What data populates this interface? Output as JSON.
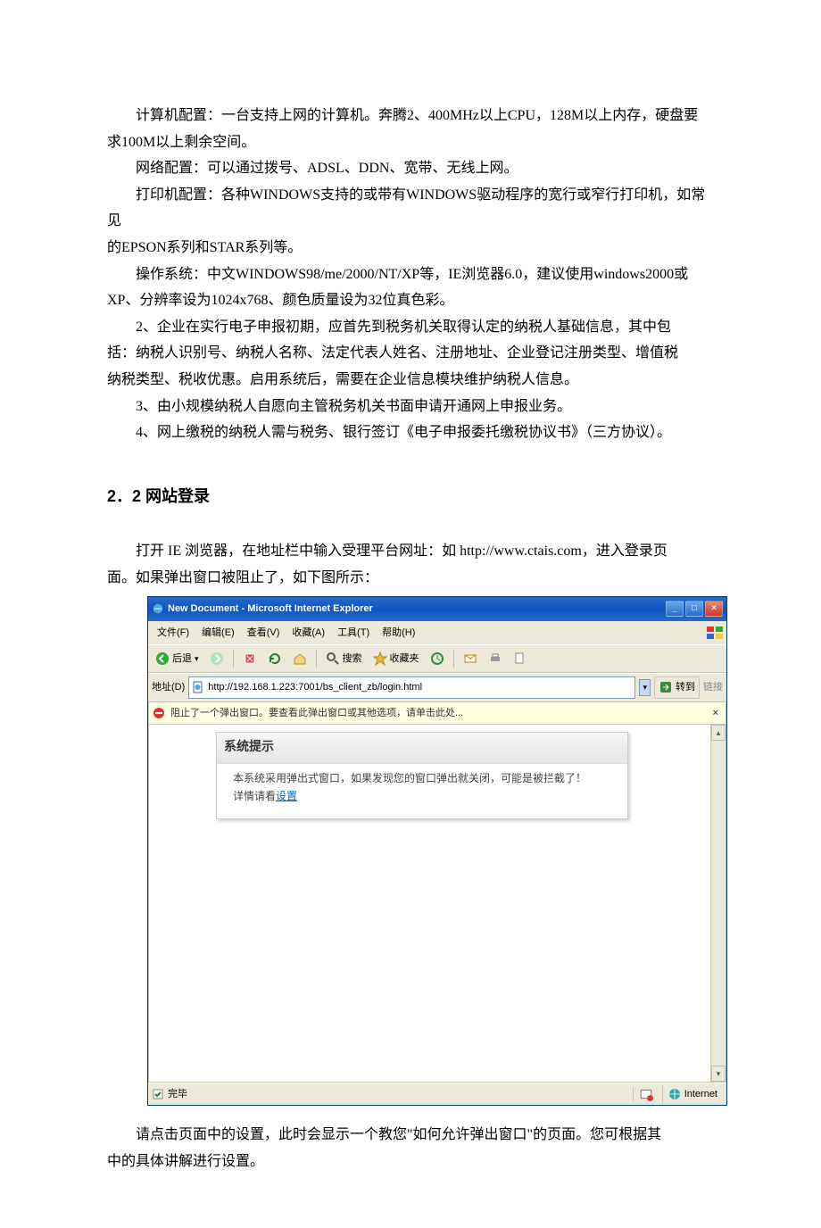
{
  "doc": {
    "p1a": "计算机配置：一台支持上网的计算机。奔腾2、400MHz以上CPU，128M以上内存，硬盘要",
    "p1b": "求100M以上剩余空间。",
    "p2": "网络配置：可以通过拨号、ADSL、DDN、宽带、无线上网。",
    "p3a": "打印机配置：各种WINDOWS支持的或带有WINDOWS驱动程序的宽行或窄行打印机，如常见",
    "p3b": "的EPSON系列和STAR系列等。",
    "p4a": "操作系统：中文WINDOWS98/me/2000/NT/XP等，IE浏览器6.0，建议使用windows2000或",
    "p4b": "XP、分辨率设为1024x768、颜色质量设为32位真色彩。",
    "p5a": "2、企业在实行电子申报初期，应首先到税务机关取得认定的纳税人基础信息，其中包",
    "p5b": "括：纳税人识别号、纳税人名称、法定代表人姓名、注册地址、企业登记注册类型、增值税",
    "p5c": "纳税类型、税收优惠。启用系统后，需要在企业信息模块维护纳税人信息。",
    "p6": "3、由小规模纳税人自愿向主管税务机关书面申请开通网上申报业务。",
    "p7": "4、网上缴税的纳税人需与税务、银行签订《电子申报委托缴税协议书》（三方协议）。",
    "h2": "2．2 网站登录",
    "p8a": "打开 IE 浏览器，在地址栏中输入受理平台网址：如 http://www.ctais.com，进入登录页",
    "p8b": "面。如果弹出窗口被阻止了，如下图所示：",
    "p9a": "请点击页面中的设置，此时会显示一个教您\"如何允许弹出窗口\"的页面。您可根据其",
    "p9b": "中的具体讲解进行设置。"
  },
  "ie": {
    "title": "New Document - Microsoft Internet Explorer",
    "menu": {
      "m0": "文件(F)",
      "m1": "编辑(E)",
      "m2": "查看(V)",
      "m3": "收藏(A)",
      "m4": "工具(T)",
      "m5": "帮助(H)"
    },
    "toolbar": {
      "back": "后退",
      "search": "搜索",
      "fav": "收藏夹"
    },
    "addr": {
      "label": "地址(D)",
      "url": "http://192.168.1.223:7001/bs_client_zb/login.html",
      "go": "转到",
      "links": "链接"
    },
    "infobar": {
      "text": "阻止了一个弹出窗口。要查看此弹出窗口或其他选项，请单击此处...",
      "close": "×"
    },
    "msg": {
      "title": "系统提示",
      "line1": "本系统采用弹出式窗口，如果发现您的窗口弹出就关闭，可能是被拦截了！",
      "line2a": "详情请看",
      "link": "设置"
    },
    "status": {
      "done": "完毕",
      "zone": "Internet"
    }
  }
}
